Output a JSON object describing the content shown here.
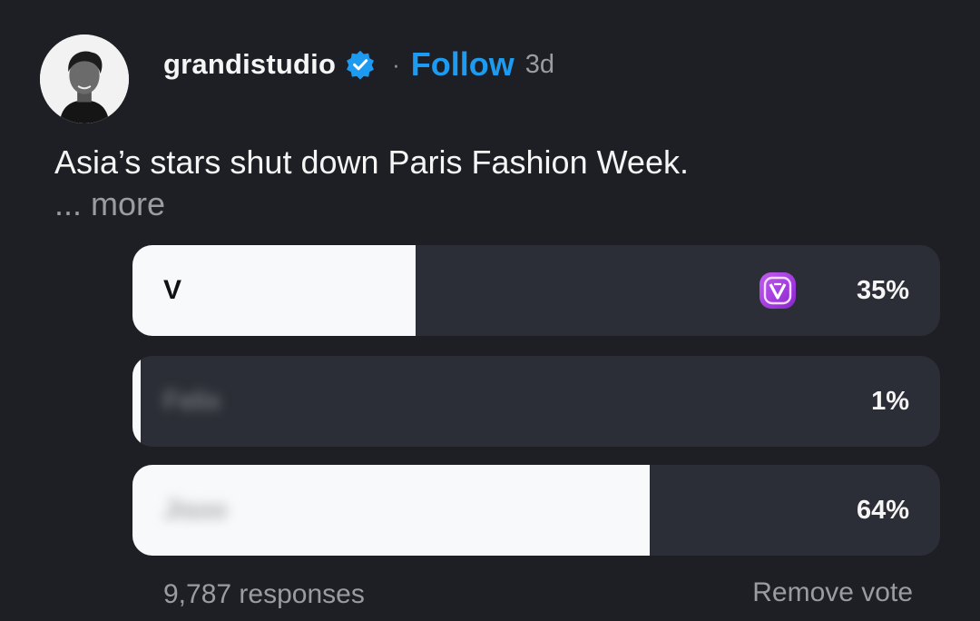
{
  "post": {
    "username": "grandistudio",
    "separator": "·",
    "follow_label": "Follow",
    "age": "3d",
    "caption": "Asia’s stars shut down Paris Fashion Week.",
    "more_label": "... more"
  },
  "poll": {
    "options": [
      {
        "label": "V",
        "percent_label": "35%",
        "percent": 35,
        "selected": true
      },
      {
        "label": "Felix",
        "percent_label": "1%",
        "percent": 1,
        "selected": false
      },
      {
        "label": "Jisoo",
        "percent_label": "64%",
        "percent": 64,
        "selected": false
      }
    ],
    "responses_label": "9,787 responses",
    "remove_vote_label": "Remove vote"
  },
  "icons": {
    "verified": "verified-badge-icon",
    "vote_marker": "voted-check-icon"
  },
  "colors": {
    "background": "#1e1f24",
    "follow": "#1d9bf0",
    "verified": "#1d9bf0",
    "bar_fill": "#f8f9fa",
    "bar_track": "#2b2e36",
    "vote_marker": "#a33ee0"
  }
}
